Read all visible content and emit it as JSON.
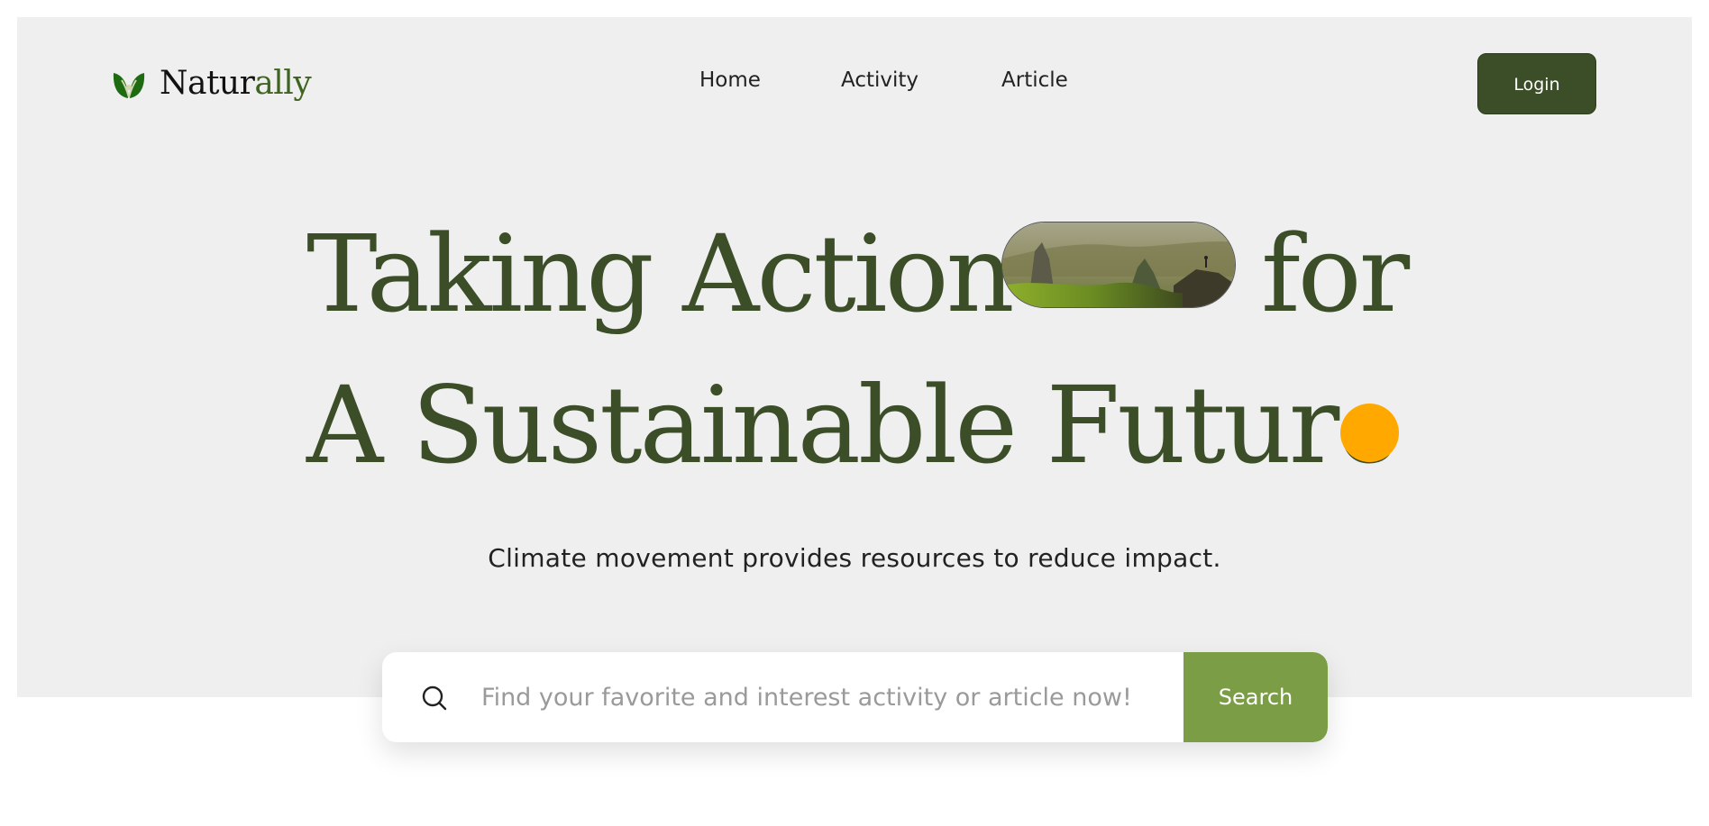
{
  "brand": {
    "name_main": "Natur",
    "name_accent": "ally",
    "logo_icon": "leaf-icon",
    "accent_color": "#3f6420"
  },
  "nav": {
    "items": [
      {
        "label": "Home"
      },
      {
        "label": "Activity"
      },
      {
        "label": "Article"
      }
    ],
    "login_label": "Login"
  },
  "hero": {
    "headline_line1_start": "Taking Action",
    "headline_line1_end": "for",
    "headline_line2": "A Sustainable Future",
    "subtitle": "Climate movement provides resources to reduce impact.",
    "headline_color": "#3b4e28",
    "dot_color": "#ffa800"
  },
  "search": {
    "placeholder": "Find your favorite and interest activity or article now!",
    "button_label": "Search",
    "button_color": "#7b9d46",
    "icon": "search-icon"
  },
  "colors": {
    "hero_background": "#efefef",
    "login_button": "#3b4e28"
  }
}
